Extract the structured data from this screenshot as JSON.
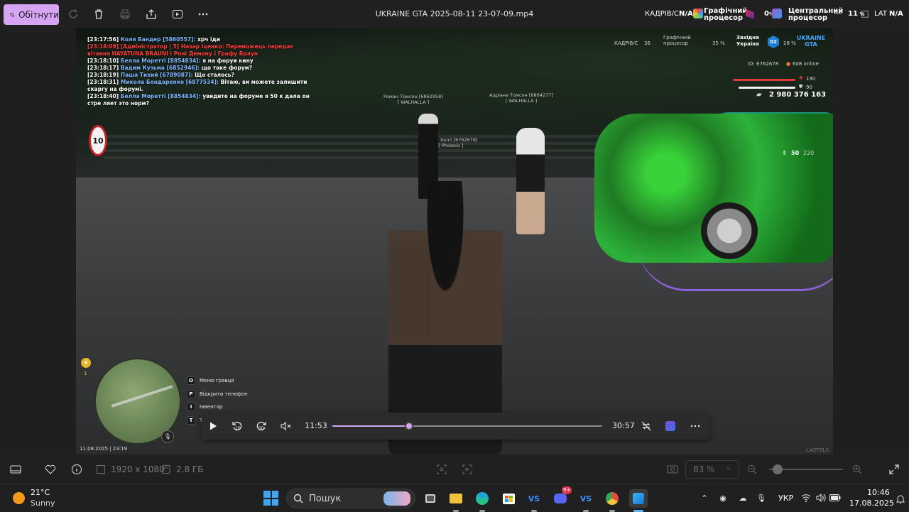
{
  "toolbar": {
    "crop_label": "Обітнути",
    "file_title": "UKRAINE GTA 2025-08-11 23-07-09.mp4"
  },
  "perf_overlay": {
    "fps_label": "КАДРІВ/С",
    "fps_value": "N/A",
    "gpu_label_line1": "Графічний",
    "gpu_label_line2": "процесор",
    "gpu_value": "0",
    "cpu_label_line1": "Центральний",
    "cpu_label_line2": "процесор",
    "cpu_value": "11",
    "lat_label": "LAT",
    "lat_value": "N/A"
  },
  "game": {
    "chat": [
      {
        "time": "[23:17:56]",
        "name": "Коля Бандер [5860557]:",
        "text": "хрч іди",
        "color": "normal"
      },
      {
        "time": "[23:18:09]",
        "name": "[Адміністратор | 5]",
        "text": "Назар Іценко: Переможець передає вітання HAYATUNA BRAUNI і Роні Демону і Графу Браун",
        "color": "red"
      },
      {
        "time": "[23:18:10]",
        "name": "Белла Моретті [8854834]:",
        "text": "я на форуи кину",
        "color": "normal"
      },
      {
        "time": "[23:18:17]",
        "name": "Вадим Кузьма [6852946]:",
        "text": "що таке форум?",
        "color": "normal"
      },
      {
        "time": "[23:18:19]",
        "name": "Паша Тихий [6789087]:",
        "text": "Що сталось?",
        "color": "normal"
      },
      {
        "time": "[23:18:31]",
        "name": "Микола Бондаренко [6877534]:",
        "text": "Вітаю, ви можете залишити скаргу на форумі.",
        "color": "normal"
      },
      {
        "time": "[23:18:40]",
        "name": "Белла Моретті [8854834]:",
        "text": "увидите на форуме я 50 к дала он стре ляет это норм?",
        "color": "normal"
      }
    ],
    "speed_sign": "10",
    "tags": [
      {
        "name": "Роман Томсон [6862958]",
        "group": "[ WALHALLA ]"
      },
      {
        "name": "Адріана Томсон [6864277]",
        "group": "[ WALHALLA ]"
      },
      {
        "name": "Кочан Холл [6762678]",
        "group": "[ Phoenix ]"
      }
    ],
    "hud": {
      "fps_label": "КАДРІВ/С",
      "fps_value": "36",
      "gpu_label": "Графічний процесор",
      "gpu_value": "35 %",
      "region": "Західна Україна",
      "server": "02",
      "cpu_value": "28 %",
      "logo_line1": "UKRAINE",
      "logo_line2": "GTA",
      "id_text": "ID: 6762678",
      "online_text": "608 online",
      "health": "190",
      "armor": "90",
      "money": "2 980 376 163",
      "ammo_clip": "50",
      "ammo_total": "220"
    },
    "wanted_level": "1",
    "key_hints": [
      {
        "key": "O",
        "label": "Меню гравця"
      },
      {
        "key": "P",
        "label": "Відкрити телефон"
      },
      {
        "key": "I",
        "label": "Інвентар"
      },
      {
        "key": "T",
        "label": "Т"
      }
    ],
    "date_stamp": "11.08.2025 | 23:19",
    "watermark": "LAGTOLS"
  },
  "player": {
    "current_time": "11:53",
    "total_time": "30:57",
    "progress": 0.284,
    "accent_color": "#d6a4f2"
  },
  "infobar": {
    "dimensions": "1920 x 1080",
    "file_size": "2.8 ГБ",
    "zoom": "83 %"
  },
  "taskbar": {
    "weather_temp": "21°C",
    "weather_desc": "Sunny",
    "search_placeholder": "Пошук",
    "discord_badge": "9+",
    "language": "УКР",
    "time": "10:46",
    "date": "17.08.2025"
  }
}
